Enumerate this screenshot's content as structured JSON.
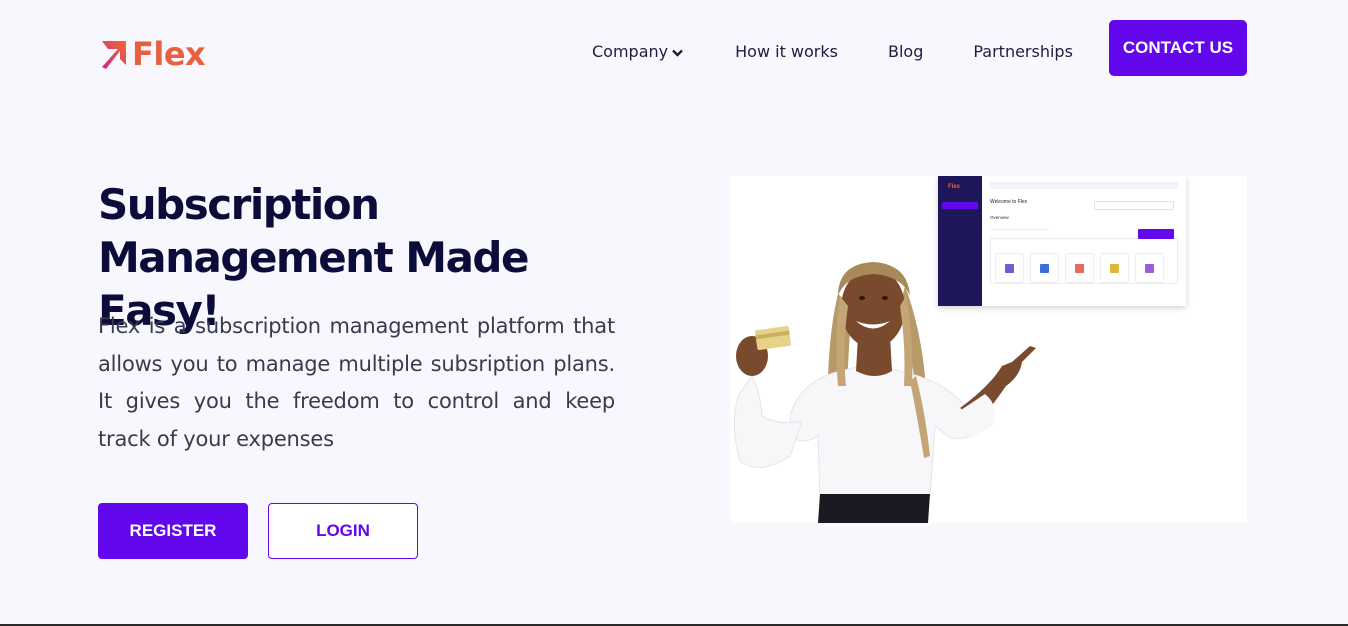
{
  "header": {
    "logo_text": "Flex",
    "nav": {
      "company": "Company",
      "how_it_works": "How it works",
      "blog": "Blog",
      "partnerships": "Partnerships"
    },
    "contact_label": "CONTACT US"
  },
  "hero": {
    "title": "Subscription Management Made Easy!",
    "description": "Flex is a subscription management platform that allows you to manage multiple subsription plans. It gives you the freedom to control and keep track of your expenses",
    "register_label": "REGISTER",
    "login_label": "LOGIN"
  },
  "dashboard_preview": {
    "logo": "Flex",
    "welcome": "Welcome to Flex",
    "overview": "Overview"
  },
  "colors": {
    "primary": "#6307ec",
    "heading": "#0c0c3a",
    "logo_orange": "#e8613f",
    "background": "#f8f7fd"
  },
  "icons": [
    "flex-logo-icon",
    "chevron-down-icon"
  ]
}
